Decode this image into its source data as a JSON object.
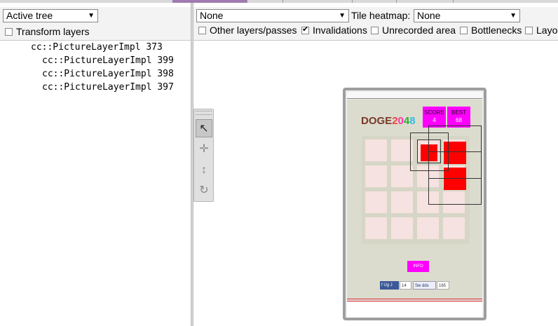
{
  "left_panel": {
    "tree_select": {
      "value": "Active tree"
    },
    "transform_layers": {
      "label": "Transform layers",
      "checked": false
    },
    "tree": [
      {
        "label": "cc::PictureLayerImpl 373",
        "depth": 0
      },
      {
        "label": "cc::PictureLayerImpl 399",
        "depth": 1
      },
      {
        "label": "cc::PictureLayerImpl 398",
        "depth": 1
      },
      {
        "label": "cc::PictureLayerImpl 397",
        "depth": 1
      }
    ]
  },
  "right_panel": {
    "layer_select": {
      "value": "None"
    },
    "tile_heatmap": {
      "label": "Tile heatmap:",
      "value": "None"
    },
    "options": [
      {
        "label": "Other layers/passes",
        "checked": false
      },
      {
        "label": "Invalidations",
        "checked": true
      },
      {
        "label": "Unrecorded area",
        "checked": false
      },
      {
        "label": "Bottlenecks",
        "checked": false
      },
      {
        "label": "Layo",
        "checked": false
      }
    ]
  },
  "tools": [
    {
      "name": "select-tool",
      "icon": "pointer-arrow-icon",
      "glyph": "↖",
      "active": true
    },
    {
      "name": "pan-tool",
      "icon": "move-cross-icon",
      "glyph": "✛",
      "active": false
    },
    {
      "name": "zoom-tool",
      "icon": "vertical-arrows-icon",
      "glyph": "↕",
      "active": false
    },
    {
      "name": "rotate-tool",
      "icon": "rotate-icon",
      "glyph": "↻",
      "active": false
    }
  ],
  "viewport": {
    "game": {
      "logo_parts": [
        "DOGE",
        "2",
        "0",
        "4",
        "8"
      ],
      "score": {
        "label": "SCORE",
        "value": "4"
      },
      "best": {
        "label": "BEST",
        "value": "68"
      },
      "info_label": "INFO",
      "social": {
        "fb_label": "f Ug J",
        "fb_count": "14",
        "tw_label": "Sw dds",
        "tw_count": "165"
      }
    }
  },
  "colors": {
    "tile": "#ff0000",
    "score_box": "#ff00ff",
    "grid_cell": "#f6e2e0",
    "page_bg": "#dcdcce"
  }
}
